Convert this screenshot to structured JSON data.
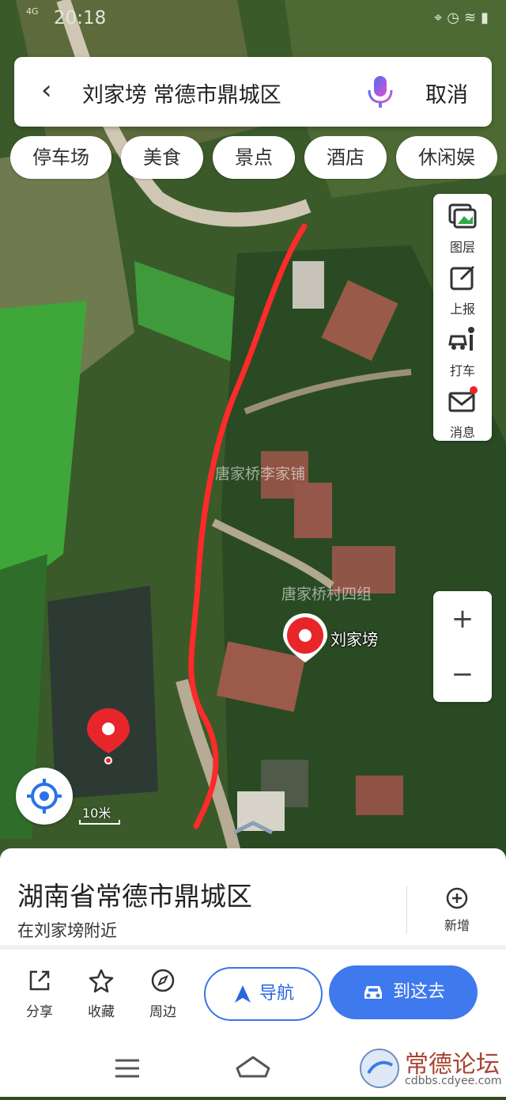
{
  "status_bar": {
    "time": "20:18",
    "network": "4G"
  },
  "search": {
    "query": "刘家塝 常德市鼎城区",
    "cancel_label": "取消"
  },
  "categories": [
    "停车场",
    "美食",
    "景点",
    "酒店",
    "休闲娱"
  ],
  "map_tools": [
    {
      "icon": "layers-icon",
      "label": "图层"
    },
    {
      "icon": "report-icon",
      "label": "上报"
    },
    {
      "icon": "taxi-icon",
      "label": "打车"
    },
    {
      "icon": "message-icon",
      "label": "消息"
    }
  ],
  "zoom": {
    "in": "+",
    "out": "−"
  },
  "map_labels": [
    "唐家桥李家铺",
    "唐家桥村四组"
  ],
  "marker_label": "刘家塝",
  "scale_label": "10米",
  "place": {
    "title": "湖南省常德市鼎城区",
    "subtitle": "在刘家塝附近",
    "add_label": "新增"
  },
  "actions": [
    {
      "icon": "share-icon",
      "label": "分享"
    },
    {
      "icon": "star-icon",
      "label": "收藏"
    },
    {
      "icon": "compass-icon",
      "label": "周边"
    }
  ],
  "nav_button": "导航",
  "go_button": "到这去",
  "watermark": {
    "title": "常德论坛",
    "url": "cdbbs.cdyee.com"
  },
  "colors": {
    "accent": "#3e79ee",
    "route": "#ff2a2a",
    "marker": "#e8262a"
  }
}
